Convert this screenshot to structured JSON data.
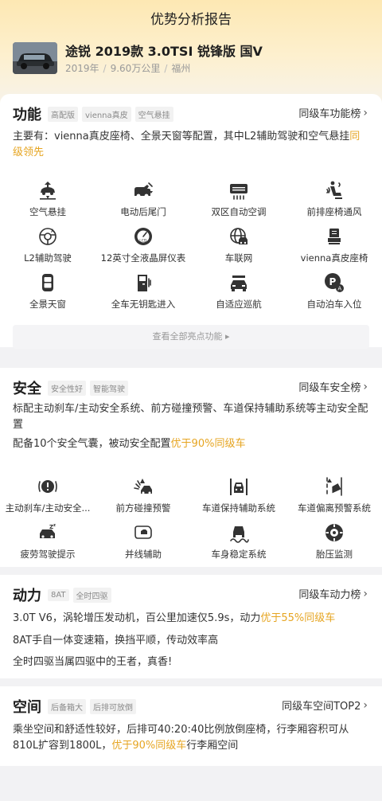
{
  "page": {
    "title": "优势分析报告"
  },
  "car": {
    "name": "途锐 2019款 3.0TSI 锐锋版 国V",
    "year": "2019年",
    "mileage": "9.60万公里",
    "city": "福州"
  },
  "function": {
    "title": "功能",
    "tags": [
      "高配版",
      "vienna真皮",
      "空气悬挂"
    ],
    "rank_link": "同级车功能榜",
    "desc_prefix": "主要有：vienna真皮座椅、全景天窗等配置，其中L2辅助驾驶和空气悬挂",
    "desc_highlight": "同级领先",
    "features": [
      {
        "label": "空气悬挂",
        "icon": "air-suspension-icon"
      },
      {
        "label": "电动后尾门",
        "icon": "power-tailgate-icon"
      },
      {
        "label": "双区自动空调",
        "icon": "dual-zone-ac-icon"
      },
      {
        "label": "前排座椅通风",
        "icon": "seat-ventilation-icon"
      },
      {
        "label": "L2辅助驾驶",
        "icon": "l2-assist-icon"
      },
      {
        "label": "12英寸全液晶屏仪表",
        "icon": "lcd-dashboard-icon"
      },
      {
        "label": "车联网",
        "icon": "connected-car-icon"
      },
      {
        "label": "vienna真皮座椅",
        "icon": "leather-seat-icon"
      },
      {
        "label": "全景天窗",
        "icon": "panoramic-sunroof-icon"
      },
      {
        "label": "全车无钥匙进入",
        "icon": "keyless-entry-icon"
      },
      {
        "label": "自适应巡航",
        "icon": "adaptive-cruise-icon"
      },
      {
        "label": "自动泊车入位",
        "icon": "auto-parking-icon"
      }
    ],
    "view_all": "查看全部亮点功能"
  },
  "safety": {
    "title": "安全",
    "tags": [
      "安全性好",
      "智能驾驶"
    ],
    "rank_link": "同级车安全榜",
    "desc1": "标配主动刹车/主动安全系统、前方碰撞预警、车道保持辅助系统等主动安全配置",
    "desc2_prefix": "配备10个安全气囊，被动安全配置",
    "desc2_highlight": "优于90%同级车",
    "features": [
      {
        "label": "主动刹车/主动安全...",
        "icon": "active-braking-icon"
      },
      {
        "label": "前方碰撞预警",
        "icon": "collision-warning-icon"
      },
      {
        "label": "车道保持辅助系统",
        "icon": "lane-keep-icon"
      },
      {
        "label": "车道偏离预警系统",
        "icon": "lane-departure-icon"
      },
      {
        "label": "疲劳驾驶提示",
        "icon": "fatigue-alert-icon"
      },
      {
        "label": "并线辅助",
        "icon": "blind-spot-icon"
      },
      {
        "label": "车身稳定系统",
        "icon": "stability-control-icon"
      },
      {
        "label": "胎压监测",
        "icon": "tire-pressure-icon"
      }
    ]
  },
  "power": {
    "title": "动力",
    "tags": [
      "8AT",
      "全时四驱"
    ],
    "rank_link": "同级车动力榜",
    "line1_prefix": "3.0T V6，涡轮增压发动机，百公里加速仅5.9s，动力",
    "line1_highlight": "优于55%同级车",
    "line2": "8AT手自一体变速箱，换挡平顺，传动效率高",
    "line3": "全时四驱当属四驱中的王者，真香!"
  },
  "space": {
    "title": "空间",
    "tags": [
      "后备箱大",
      "后排可放倒"
    ],
    "rank_link": "同级车空间TOP2",
    "desc_prefix": "乘坐空间和舒适性较好，后排可40:20:40比例放倒座椅，行李厢容积可从810L扩容到1800L，",
    "desc_highlight": "优于90%同级车",
    "desc_suffix": "行李厢空间"
  }
}
